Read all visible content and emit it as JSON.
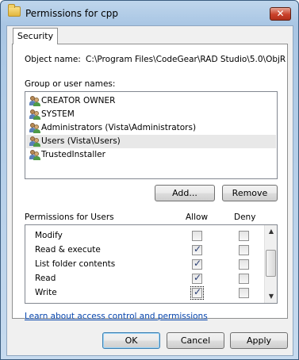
{
  "window": {
    "title": "Permissions for cpp",
    "close_glyph": "✕"
  },
  "tabs": [
    {
      "label": "Security"
    }
  ],
  "object_name": {
    "label": "Object name:",
    "value": "C:\\Program Files\\CodeGear\\RAD Studio\\5.0\\ObjR"
  },
  "groups": {
    "label": "Group or user names:",
    "items": [
      {
        "name": "CREATOR OWNER",
        "icon": "user-group-icon"
      },
      {
        "name": "SYSTEM",
        "icon": "user-group-icon"
      },
      {
        "name": "Administrators (Vista\\Administrators)",
        "icon": "user-group-icon"
      },
      {
        "name": "Users (Vista\\Users)",
        "icon": "user-group-icon",
        "selected": true
      },
      {
        "name": "TrustedInstaller",
        "icon": "user-group-icon"
      }
    ],
    "add_button": "Add...",
    "remove_button": "Remove"
  },
  "permissions": {
    "label": "Permissions for Users",
    "allow_header": "Allow",
    "deny_header": "Deny",
    "rows": [
      {
        "name": "Modify",
        "allow": false,
        "deny": false
      },
      {
        "name": "Read & execute",
        "allow": true,
        "deny": false
      },
      {
        "name": "List folder contents",
        "allow": true,
        "deny": false
      },
      {
        "name": "Read",
        "allow": true,
        "deny": false
      },
      {
        "name": "Write",
        "allow": true,
        "deny": false,
        "focused": true
      }
    ]
  },
  "link": "Learn about access control and permissions",
  "buttons": {
    "ok": "OK",
    "cancel": "Cancel",
    "apply": "Apply"
  }
}
